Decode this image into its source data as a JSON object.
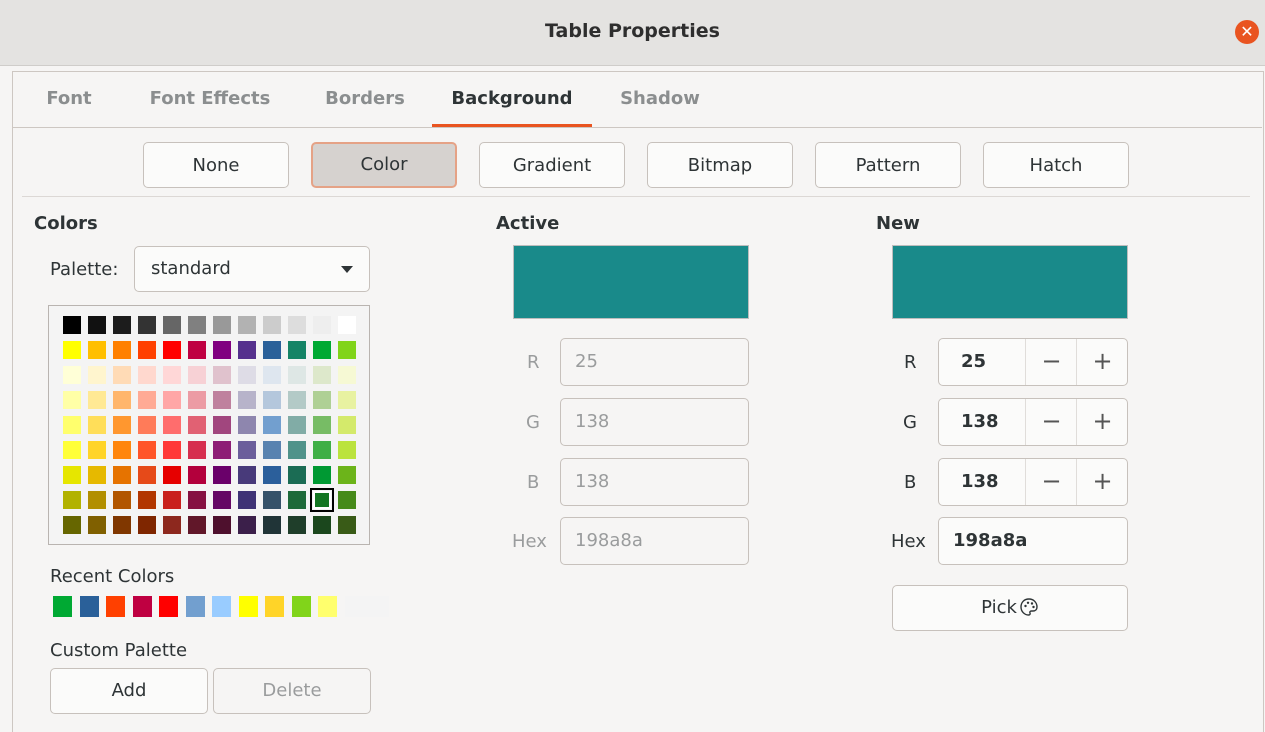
{
  "window": {
    "title": "Table Properties",
    "close_icon": "close-icon"
  },
  "tabs": [
    {
      "label": "Font",
      "active": false
    },
    {
      "label": "Font Effects",
      "active": false
    },
    {
      "label": "Borders",
      "active": false
    },
    {
      "label": "Background",
      "active": true
    },
    {
      "label": "Shadow",
      "active": false
    }
  ],
  "fill_types": [
    "None",
    "Color",
    "Gradient",
    "Bitmap",
    "Pattern",
    "Hatch"
  ],
  "selected_fill_type": "Color",
  "colors": {
    "heading": "Colors",
    "palette_label": "Palette:",
    "palette_value": "standard",
    "grid": [
      [
        "#000000",
        "#111111",
        "#1c1c1c",
        "#333333",
        "#666666",
        "#808080",
        "#999999",
        "#b2b2b2",
        "#cccccc",
        "#dddddd",
        "#eeeeee",
        "#ffffff"
      ],
      [
        "#ffff00",
        "#ffbf00",
        "#ff8000",
        "#ff4000",
        "#ff0000",
        "#bf0041",
        "#800080",
        "#55308d",
        "#2a6099",
        "#158466",
        "#00a933",
        "#81d41a"
      ],
      [
        "#ffffd7",
        "#fff5ce",
        "#ffdbb6",
        "#ffd8ce",
        "#ffd7d7",
        "#f7d1d5",
        "#e0c2cd",
        "#dedce6",
        "#dee6ef",
        "#dee7e5",
        "#dde8cb",
        "#f6f9d4"
      ],
      [
        "#ffffa6",
        "#ffe994",
        "#ffb66c",
        "#ffaa95",
        "#ffa6a6",
        "#ec9ba4",
        "#bf819e",
        "#b7b3ca",
        "#b4c7dc",
        "#b3cac7",
        "#afd095",
        "#e8f2a1"
      ],
      [
        "#ffff6d",
        "#ffde59",
        "#ff972f",
        "#ff7b59",
        "#ff6d6d",
        "#e16173",
        "#a1467e",
        "#8e86ae",
        "#729fcf",
        "#81aca6",
        "#77bc65",
        "#d4ea6b"
      ],
      [
        "#ffff38",
        "#ffd428",
        "#ff860d",
        "#ff5429",
        "#ff3838",
        "#d62e4e",
        "#8d1d75",
        "#6b5e9b",
        "#5983b0",
        "#50938a",
        "#3faf46",
        "#bbe33d"
      ],
      [
        "#e6e600",
        "#e6b900",
        "#e67300",
        "#e64a19",
        "#e60000",
        "#b3003c",
        "#6a006a",
        "#483a7a",
        "#2b5f9b",
        "#1b6c54",
        "#009933",
        "#6cb41a"
      ],
      [
        "#b2b200",
        "#b28f00",
        "#b25600",
        "#b23600",
        "#c9211e",
        "#861141",
        "#650865",
        "#3e3275",
        "#355269",
        "#1e6a39",
        "#127622",
        "#468a1a"
      ],
      [
        "#666600",
        "#806000",
        "#803700",
        "#7f2600",
        "#8d281e",
        "#611729",
        "#4e102d",
        "#3b1f4a",
        "#203437",
        "#1f3e2a",
        "#1b471d",
        "#395b17"
      ]
    ],
    "selected_color": "#127622",
    "recent_label": "Recent Colors",
    "recent": [
      "#00a933",
      "#2a6099",
      "#ff4000",
      "#bf0041",
      "#ff0000",
      "#729fcf",
      "#99ccff",
      "#ffff00",
      "#ffd428",
      "#81d41a",
      "#ffff6d",
      "#f4f4f4"
    ],
    "custom_label": "Custom Palette",
    "add_label": "Add",
    "delete_label": "Delete"
  },
  "active": {
    "heading": "Active",
    "color": "#198a8a",
    "r_label": "R",
    "r": "25",
    "g_label": "G",
    "g": "138",
    "b_label": "B",
    "b": "138",
    "hex_label": "Hex",
    "hex": "198a8a"
  },
  "new": {
    "heading": "New",
    "color": "#198a8a",
    "r_label": "R",
    "r": "25",
    "g_label": "G",
    "g": "138",
    "b_label": "B",
    "b": "138",
    "hex_label": "Hex",
    "hex": "198a8a",
    "minus": "−",
    "plus": "+",
    "pick_label": "Pick",
    "pick_icon": "palette-icon"
  },
  "accent_color": "#e95420"
}
